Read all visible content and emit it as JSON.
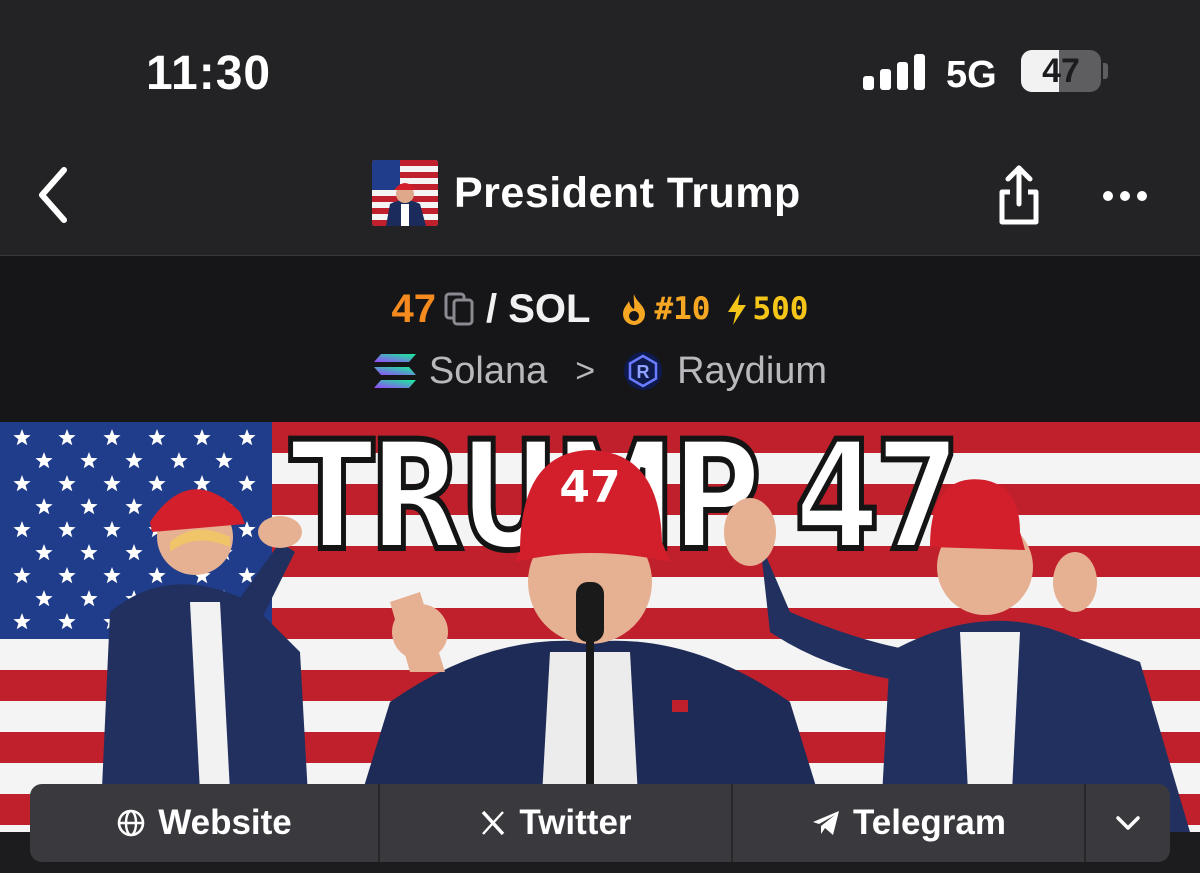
{
  "status_bar": {
    "time": "11:30",
    "network": "5G",
    "battery_level": "47",
    "battery_fraction": 0.47,
    "signal_bars": 4
  },
  "nav": {
    "title": "President Trump",
    "back_icon": "chevron-left-icon",
    "share_icon": "share-icon",
    "more_icon": "more-dots-icon"
  },
  "pair": {
    "base_symbol": "47",
    "quote": "/ SOL",
    "trending_rank": "#10",
    "boost": "500",
    "colors": {
      "base": "#f58a1f",
      "rank": "#f5a623",
      "boost": "#f5c518"
    }
  },
  "chain": {
    "network": "Solana",
    "separator": ">",
    "dex": "Raydium"
  },
  "banner": {
    "headline": "TRUMP 47",
    "hat_text": "47"
  },
  "links": {
    "website": "Website",
    "twitter": "Twitter",
    "telegram": "Telegram"
  }
}
